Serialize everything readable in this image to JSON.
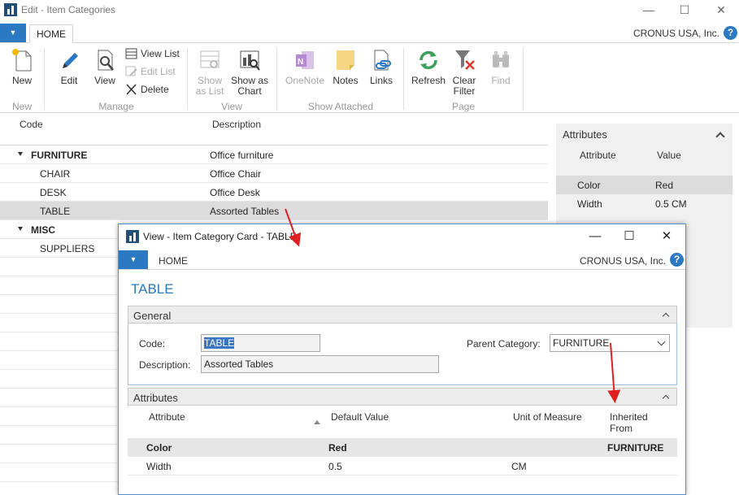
{
  "main_window": {
    "title": "Edit - Item Categories",
    "tab_file": "▼",
    "tab_home": "HOME",
    "company": "CRONUS USA, Inc.",
    "help": "?"
  },
  "ribbon": {
    "new": "New",
    "edit": "Edit",
    "view": "View",
    "view_list": "View List",
    "edit_list": "Edit List",
    "delete": "Delete",
    "show_as_list": "Show as List",
    "show_as_chart": "Show as Chart",
    "onenote": "OneNote",
    "notes": "Notes",
    "links": "Links",
    "refresh": "Refresh",
    "clear_filter": "Clear Filter",
    "find": "Find",
    "groups": {
      "new": "New",
      "manage": "Manage",
      "view": "View",
      "show_attached": "Show Attached",
      "page": "Page"
    }
  },
  "list": {
    "col_code": "Code",
    "col_description": "Description",
    "rows": [
      {
        "code": "FURNITURE",
        "description": "Office furniture"
      },
      {
        "code": "CHAIR",
        "description": "Office Chair"
      },
      {
        "code": "DESK",
        "description": "Office Desk"
      },
      {
        "code": "TABLE",
        "description": "Assorted Tables"
      },
      {
        "code": "MISC",
        "description": ""
      },
      {
        "code": "SUPPLIERS",
        "description": ""
      }
    ]
  },
  "factbox": {
    "title": "Attributes",
    "col_attribute": "Attribute",
    "col_value": "Value",
    "rows": [
      {
        "attribute": "Color",
        "value": "Red"
      },
      {
        "attribute": "Width",
        "value": "0.5 CM"
      }
    ]
  },
  "dialog": {
    "title": "View - Item Category Card - TABLE",
    "tab_file": "▼",
    "tab_home": "HOME",
    "company": "CRONUS USA, Inc.",
    "help": "?",
    "heading": "TABLE",
    "general": {
      "title": "General",
      "code_label": "Code:",
      "code_value": "TABLE",
      "description_label": "Description:",
      "description_value": "Assorted Tables",
      "parent_label": "Parent Category:",
      "parent_value": "FURNITURE"
    },
    "attributes": {
      "title": "Attributes",
      "col_attribute": "Attribute",
      "col_default_value": "Default Value",
      "col_unit": "Unit of Measure",
      "col_inherited_line1": "Inherited",
      "col_inherited_line2": "From",
      "rows": [
        {
          "attribute": "Color",
          "default_value": "Red",
          "unit": "",
          "inherited_from": "FURNITURE"
        },
        {
          "attribute": "Width",
          "default_value": "0.5",
          "unit": "CM",
          "inherited_from": ""
        }
      ]
    }
  },
  "colors": {
    "accent_blue": "#2b79c2",
    "arrow_red": "#e02020",
    "selection_gray": "#dcdcdc"
  }
}
